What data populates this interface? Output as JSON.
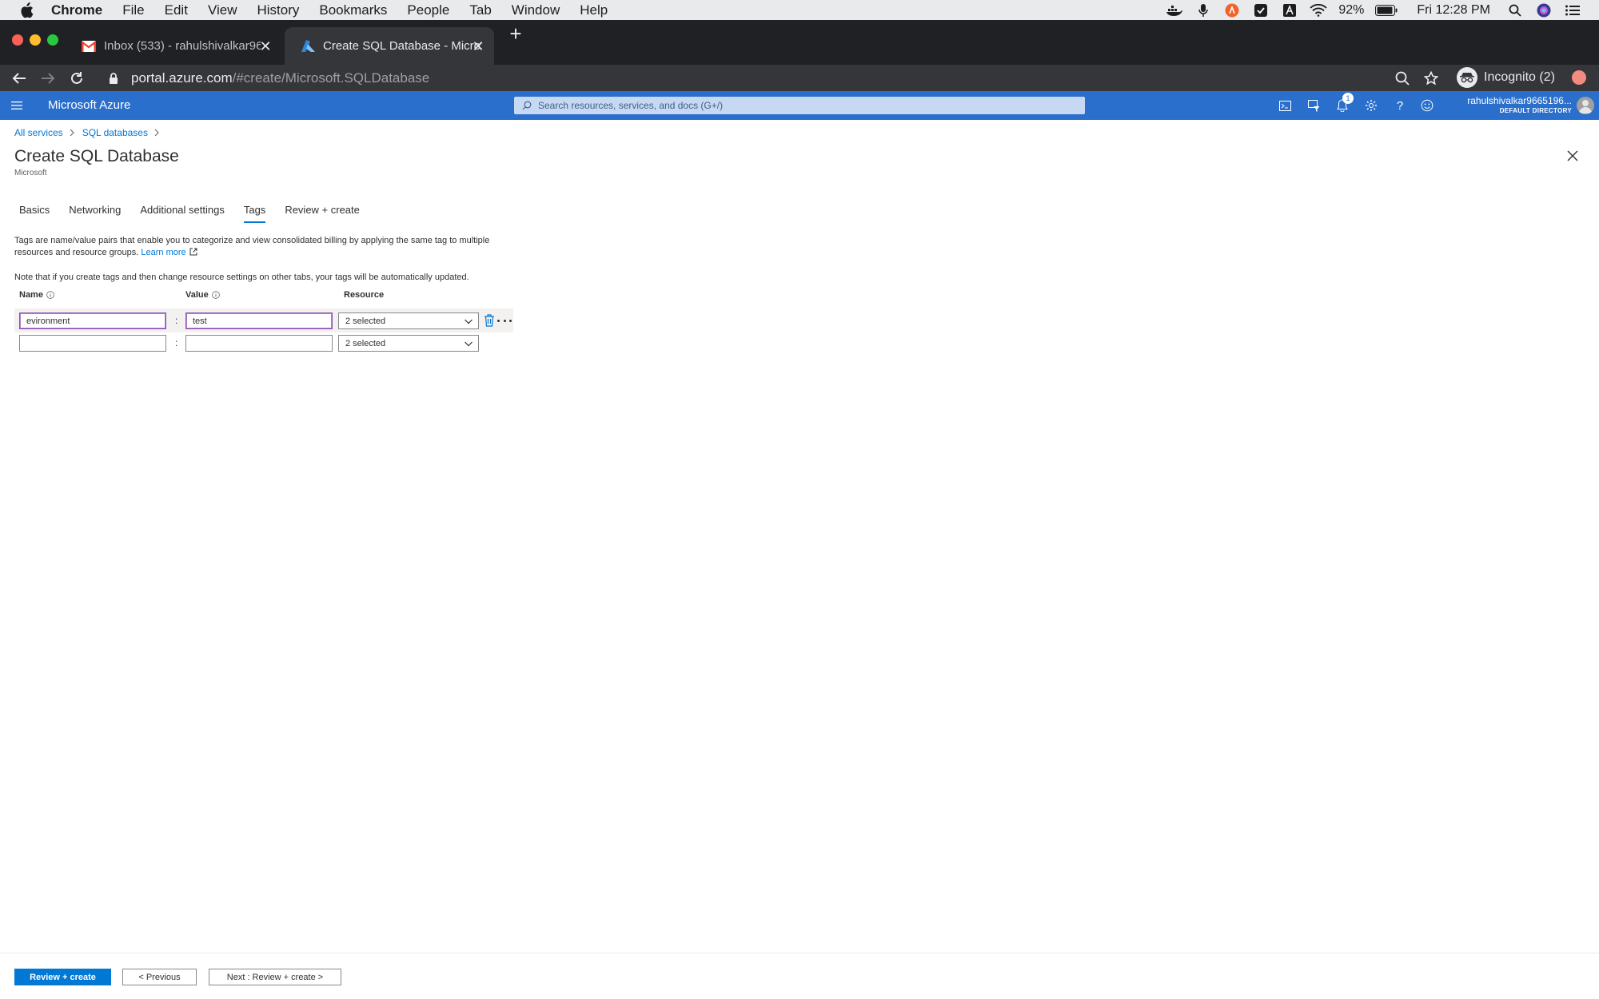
{
  "macos_menubar": {
    "app_name": "Chrome",
    "menus": [
      "File",
      "Edit",
      "View",
      "History",
      "Bookmarks",
      "People",
      "Tab",
      "Window",
      "Help"
    ],
    "battery": "92%",
    "clock": "Fri 12:28 PM"
  },
  "chrome": {
    "tabs": [
      {
        "title": "Inbox (533) - rahulshivalkar96"
      },
      {
        "title": "Create SQL Database - Micros"
      }
    ],
    "url_host": "portal.azure.com",
    "url_path": "/#create/Microsoft.SQLDatabase",
    "incognito_label": "Incognito (2)"
  },
  "azure_header": {
    "brand": "Microsoft Azure",
    "search_placeholder": "Search resources, services, and docs (G+/)",
    "notification_count": "1",
    "user_name": "rahulshivalkar9665196...",
    "directory": "DEFAULT DIRECTORY"
  },
  "breadcrumb": [
    "All services",
    "SQL databases"
  ],
  "page": {
    "title": "Create SQL Database",
    "subtitle": "Microsoft"
  },
  "form_tabs": [
    "Basics",
    "Networking",
    "Additional settings",
    "Tags",
    "Review + create"
  ],
  "active_tab": "Tags",
  "description": {
    "text": "Tags are name/value pairs that enable you to categorize and view consolidated billing by applying the same tag to multiple resources and resource groups.",
    "link": "Learn more"
  },
  "note": "Note that if you create tags and then change resource settings on other tabs, your tags will be automatically updated.",
  "tag_columns": {
    "name": "Name",
    "value": "Value",
    "resource": "Resource"
  },
  "tag_rows": [
    {
      "name": "evironment",
      "separator": ":",
      "value": "test",
      "resource": "2 selected"
    },
    {
      "name": "",
      "separator": ":",
      "value": "",
      "resource": "2 selected"
    }
  ],
  "footer": {
    "primary": "Review + create",
    "previous": "< Previous",
    "next": "Next : Review + create >"
  },
  "colors": {
    "azure_header": "#2a6fcc",
    "link": "#0078d4",
    "focus_border": "#8b4fb5"
  }
}
